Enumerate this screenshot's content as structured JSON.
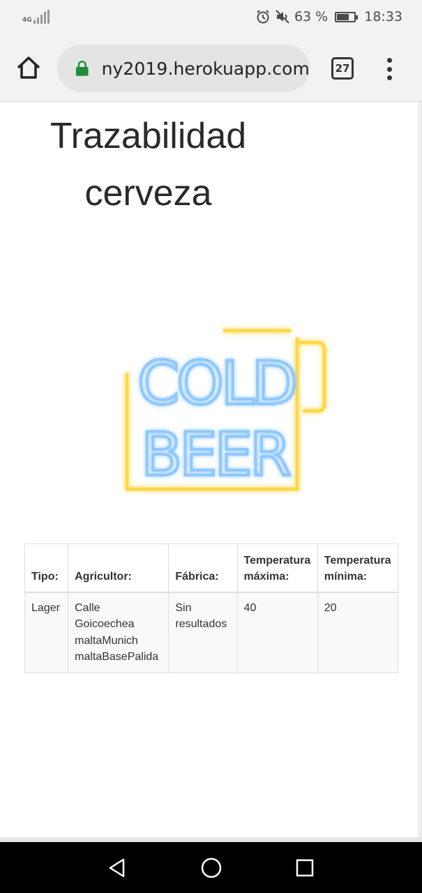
{
  "status_bar": {
    "network": "4G",
    "battery": "63 %",
    "battery_level": 0.63,
    "time": "18:33",
    "icons": [
      "alarm-icon",
      "mute-icon",
      "battery-icon",
      "signal-icon"
    ]
  },
  "browser": {
    "url": "ny2019.herokuapp.com",
    "tab_count": "27",
    "icons": [
      "home-icon",
      "lock-icon",
      "tabs-icon",
      "more-vert-icon"
    ]
  },
  "page": {
    "title_line1": "Trazabilidad",
    "title_line2": "cerveza",
    "image_text_line1": "COLD",
    "image_text_line2": "BEER"
  },
  "table": {
    "headers": [
      "Tipo:",
      "Agricultor:",
      "Fábrica:",
      "Temperatura máxima:",
      "Temperatura mínima:"
    ],
    "rows": [
      {
        "tipo": "Lager",
        "agricultor": [
          "Calle",
          "Goicoechea",
          "maltaMunich",
          "maltaBasePalida"
        ],
        "fabrica": "Sin resultados",
        "temp_max": "40",
        "temp_min": "20"
      }
    ]
  },
  "nav_bar": {
    "icons": [
      "back-icon",
      "home-circle-icon",
      "recents-icon"
    ]
  },
  "colors": {
    "neon_blue": "#8fc8ff",
    "neon_yellow": "#ffd84a",
    "lock_green": "#1e8e3e"
  }
}
